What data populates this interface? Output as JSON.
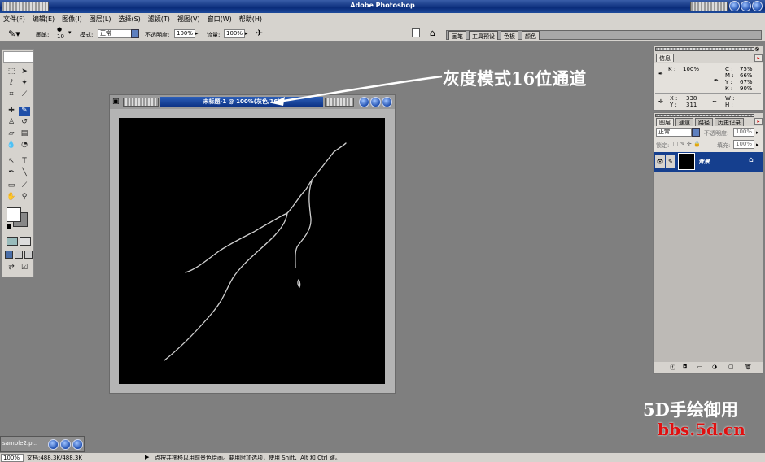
{
  "app": {
    "title": "Adobe Photoshop"
  },
  "menu": [
    "文件(F)",
    "编辑(E)",
    "图像(I)",
    "图层(L)",
    "选择(S)",
    "滤镜(T)",
    "视图(V)",
    "窗口(W)",
    "帮助(H)"
  ],
  "options": {
    "brush_label": "画笔:",
    "brush_size": "10",
    "mode_label": "模式:",
    "mode_value": "正常",
    "opacity_label": "不透明度:",
    "opacity_value": "100%",
    "flow_label": "流量:",
    "flow_value": "100%",
    "palette_tabs": [
      "画笔",
      "工具预设",
      "色板",
      "颜色"
    ]
  },
  "document": {
    "title": "未标题-1 @ 100%(灰色/16)"
  },
  "annotation": "灰度模式16位通道",
  "info_panel": {
    "tab": "信息",
    "k_label": "K :",
    "k_value": "100%",
    "c_label": "C :",
    "c_value": "75%",
    "m_label": "M :",
    "m_value": "66%",
    "y_label": "Y :",
    "y_value": "67%",
    "k2_label": "K :",
    "k2_value": "90%",
    "x_label": "X :",
    "x_value": "338",
    "yy_label": "Y :",
    "yy_value": "311",
    "w_label": "W :",
    "h_label": "H :"
  },
  "layers_panel": {
    "tabs": [
      "图层",
      "通道",
      "路径",
      "历史记录"
    ],
    "blend_mode": "正常",
    "opacity_label": "不透明度:",
    "opacity_value": "100%",
    "lock_label": "锁定:",
    "fill_label": "填充:",
    "fill_value": "100%",
    "layer_name": "背景"
  },
  "minimized_doc": {
    "title": "sample2.p..."
  },
  "status": {
    "zoom": "100%",
    "doc_info": "文档:488.3K/488.3K",
    "hint": "点按并拖移以用前景色绘画。要用附加选项，使用 Shift、Alt 和 Ctrl 键。"
  },
  "watermark": {
    "line1": "5D手绘御用",
    "line2": "bbs.5d.cn"
  }
}
